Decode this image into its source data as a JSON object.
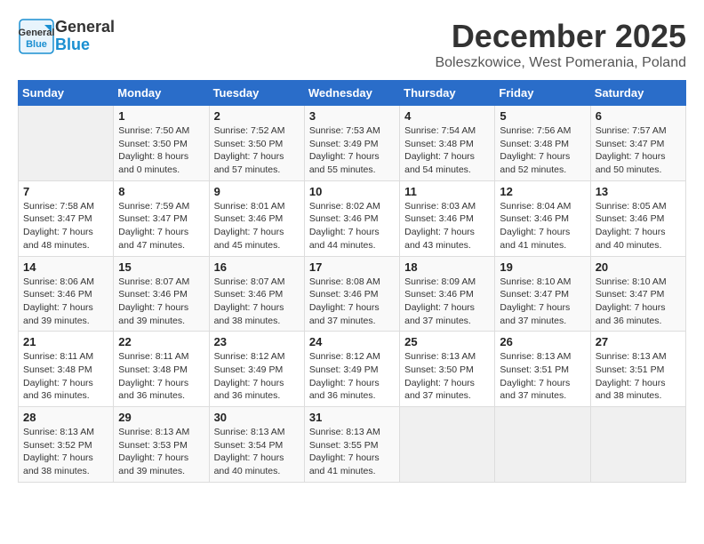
{
  "header": {
    "logo_general": "General",
    "logo_blue": "Blue",
    "title": "December 2025",
    "subtitle": "Boleszkowice, West Pomerania, Poland"
  },
  "weekdays": [
    "Sunday",
    "Monday",
    "Tuesday",
    "Wednesday",
    "Thursday",
    "Friday",
    "Saturday"
  ],
  "weeks": [
    [
      {
        "day": "",
        "sunrise": "",
        "sunset": "",
        "daylight": ""
      },
      {
        "day": "1",
        "sunrise": "Sunrise: 7:50 AM",
        "sunset": "Sunset: 3:50 PM",
        "daylight": "Daylight: 8 hours and 0 minutes."
      },
      {
        "day": "2",
        "sunrise": "Sunrise: 7:52 AM",
        "sunset": "Sunset: 3:50 PM",
        "daylight": "Daylight: 7 hours and 57 minutes."
      },
      {
        "day": "3",
        "sunrise": "Sunrise: 7:53 AM",
        "sunset": "Sunset: 3:49 PM",
        "daylight": "Daylight: 7 hours and 55 minutes."
      },
      {
        "day": "4",
        "sunrise": "Sunrise: 7:54 AM",
        "sunset": "Sunset: 3:48 PM",
        "daylight": "Daylight: 7 hours and 54 minutes."
      },
      {
        "day": "5",
        "sunrise": "Sunrise: 7:56 AM",
        "sunset": "Sunset: 3:48 PM",
        "daylight": "Daylight: 7 hours and 52 minutes."
      },
      {
        "day": "6",
        "sunrise": "Sunrise: 7:57 AM",
        "sunset": "Sunset: 3:47 PM",
        "daylight": "Daylight: 7 hours and 50 minutes."
      }
    ],
    [
      {
        "day": "7",
        "sunrise": "Sunrise: 7:58 AM",
        "sunset": "Sunset: 3:47 PM",
        "daylight": "Daylight: 7 hours and 48 minutes."
      },
      {
        "day": "8",
        "sunrise": "Sunrise: 7:59 AM",
        "sunset": "Sunset: 3:47 PM",
        "daylight": "Daylight: 7 hours and 47 minutes."
      },
      {
        "day": "9",
        "sunrise": "Sunrise: 8:01 AM",
        "sunset": "Sunset: 3:46 PM",
        "daylight": "Daylight: 7 hours and 45 minutes."
      },
      {
        "day": "10",
        "sunrise": "Sunrise: 8:02 AM",
        "sunset": "Sunset: 3:46 PM",
        "daylight": "Daylight: 7 hours and 44 minutes."
      },
      {
        "day": "11",
        "sunrise": "Sunrise: 8:03 AM",
        "sunset": "Sunset: 3:46 PM",
        "daylight": "Daylight: 7 hours and 43 minutes."
      },
      {
        "day": "12",
        "sunrise": "Sunrise: 8:04 AM",
        "sunset": "Sunset: 3:46 PM",
        "daylight": "Daylight: 7 hours and 41 minutes."
      },
      {
        "day": "13",
        "sunrise": "Sunrise: 8:05 AM",
        "sunset": "Sunset: 3:46 PM",
        "daylight": "Daylight: 7 hours and 40 minutes."
      }
    ],
    [
      {
        "day": "14",
        "sunrise": "Sunrise: 8:06 AM",
        "sunset": "Sunset: 3:46 PM",
        "daylight": "Daylight: 7 hours and 39 minutes."
      },
      {
        "day": "15",
        "sunrise": "Sunrise: 8:07 AM",
        "sunset": "Sunset: 3:46 PM",
        "daylight": "Daylight: 7 hours and 39 minutes."
      },
      {
        "day": "16",
        "sunrise": "Sunrise: 8:07 AM",
        "sunset": "Sunset: 3:46 PM",
        "daylight": "Daylight: 7 hours and 38 minutes."
      },
      {
        "day": "17",
        "sunrise": "Sunrise: 8:08 AM",
        "sunset": "Sunset: 3:46 PM",
        "daylight": "Daylight: 7 hours and 37 minutes."
      },
      {
        "day": "18",
        "sunrise": "Sunrise: 8:09 AM",
        "sunset": "Sunset: 3:46 PM",
        "daylight": "Daylight: 7 hours and 37 minutes."
      },
      {
        "day": "19",
        "sunrise": "Sunrise: 8:10 AM",
        "sunset": "Sunset: 3:47 PM",
        "daylight": "Daylight: 7 hours and 37 minutes."
      },
      {
        "day": "20",
        "sunrise": "Sunrise: 8:10 AM",
        "sunset": "Sunset: 3:47 PM",
        "daylight": "Daylight: 7 hours and 36 minutes."
      }
    ],
    [
      {
        "day": "21",
        "sunrise": "Sunrise: 8:11 AM",
        "sunset": "Sunset: 3:48 PM",
        "daylight": "Daylight: 7 hours and 36 minutes."
      },
      {
        "day": "22",
        "sunrise": "Sunrise: 8:11 AM",
        "sunset": "Sunset: 3:48 PM",
        "daylight": "Daylight: 7 hours and 36 minutes."
      },
      {
        "day": "23",
        "sunrise": "Sunrise: 8:12 AM",
        "sunset": "Sunset: 3:49 PM",
        "daylight": "Daylight: 7 hours and 36 minutes."
      },
      {
        "day": "24",
        "sunrise": "Sunrise: 8:12 AM",
        "sunset": "Sunset: 3:49 PM",
        "daylight": "Daylight: 7 hours and 36 minutes."
      },
      {
        "day": "25",
        "sunrise": "Sunrise: 8:13 AM",
        "sunset": "Sunset: 3:50 PM",
        "daylight": "Daylight: 7 hours and 37 minutes."
      },
      {
        "day": "26",
        "sunrise": "Sunrise: 8:13 AM",
        "sunset": "Sunset: 3:51 PM",
        "daylight": "Daylight: 7 hours and 37 minutes."
      },
      {
        "day": "27",
        "sunrise": "Sunrise: 8:13 AM",
        "sunset": "Sunset: 3:51 PM",
        "daylight": "Daylight: 7 hours and 38 minutes."
      }
    ],
    [
      {
        "day": "28",
        "sunrise": "Sunrise: 8:13 AM",
        "sunset": "Sunset: 3:52 PM",
        "daylight": "Daylight: 7 hours and 38 minutes."
      },
      {
        "day": "29",
        "sunrise": "Sunrise: 8:13 AM",
        "sunset": "Sunset: 3:53 PM",
        "daylight": "Daylight: 7 hours and 39 minutes."
      },
      {
        "day": "30",
        "sunrise": "Sunrise: 8:13 AM",
        "sunset": "Sunset: 3:54 PM",
        "daylight": "Daylight: 7 hours and 40 minutes."
      },
      {
        "day": "31",
        "sunrise": "Sunrise: 8:13 AM",
        "sunset": "Sunset: 3:55 PM",
        "daylight": "Daylight: 7 hours and 41 minutes."
      },
      {
        "day": "",
        "sunrise": "",
        "sunset": "",
        "daylight": ""
      },
      {
        "day": "",
        "sunrise": "",
        "sunset": "",
        "daylight": ""
      },
      {
        "day": "",
        "sunrise": "",
        "sunset": "",
        "daylight": ""
      }
    ]
  ]
}
